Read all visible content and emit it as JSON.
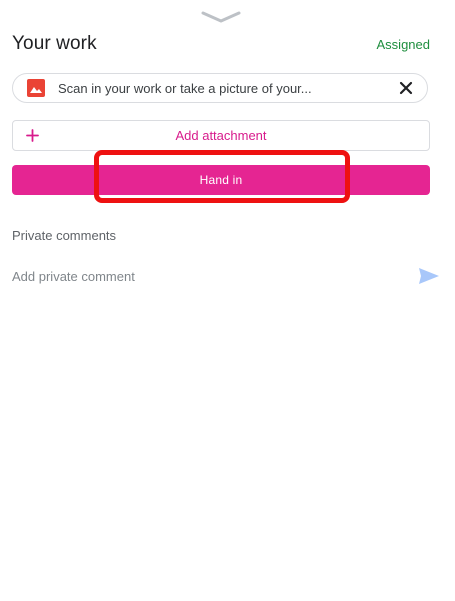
{
  "sheet": {
    "handle_icon": "chevron-down-icon"
  },
  "header": {
    "title": "Your work",
    "status": "Assigned",
    "status_color": "#1e8e3e"
  },
  "attachment": {
    "icon": "image-icon",
    "icon_color": "#ea4335",
    "name": "Scan in your work or take a picture of your...",
    "remove_icon": "close-icon"
  },
  "add_attachment": {
    "icon": "plus-icon",
    "label": "Add attachment",
    "color": "#d81b8c"
  },
  "hand_in": {
    "label": "Hand in",
    "color": "#e52592",
    "highlight_color": "#ee1111"
  },
  "private_comments": {
    "heading": "Private comments",
    "placeholder": "Add private comment",
    "value": "",
    "send_icon": "send-icon",
    "send_color": "#a8c7fa"
  }
}
